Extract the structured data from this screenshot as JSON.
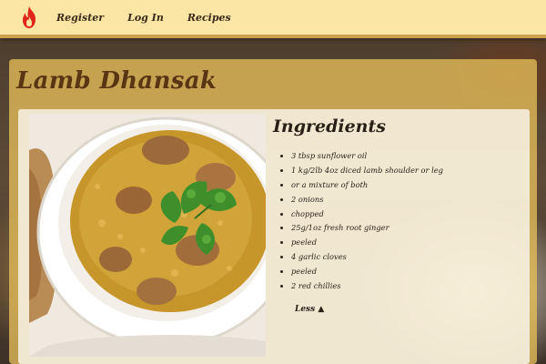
{
  "nav": {
    "logo_icon": "flame-icon",
    "links": [
      "Register",
      "Log In",
      "Recipes"
    ]
  },
  "recipe": {
    "title": "Lamb Dhansak",
    "ingredients_heading": "Ingredients",
    "ingredients": [
      "3 tbsp sunflower oil",
      "1 kg/2lb 4oz diced lamb shoulder or leg",
      "or a mixture of both",
      "2 onions",
      "chopped",
      "25g/1oz fresh root ginger",
      "peeled",
      "4 garlic cloves",
      "peeled",
      "2 red chillies"
    ],
    "toggle_label": "Less ▲"
  },
  "colors": {
    "nav_bg": "#fbe6a6",
    "panel_accent": "#e6be5a",
    "title_color": "#5a3514",
    "flame_red": "#e2231a"
  }
}
